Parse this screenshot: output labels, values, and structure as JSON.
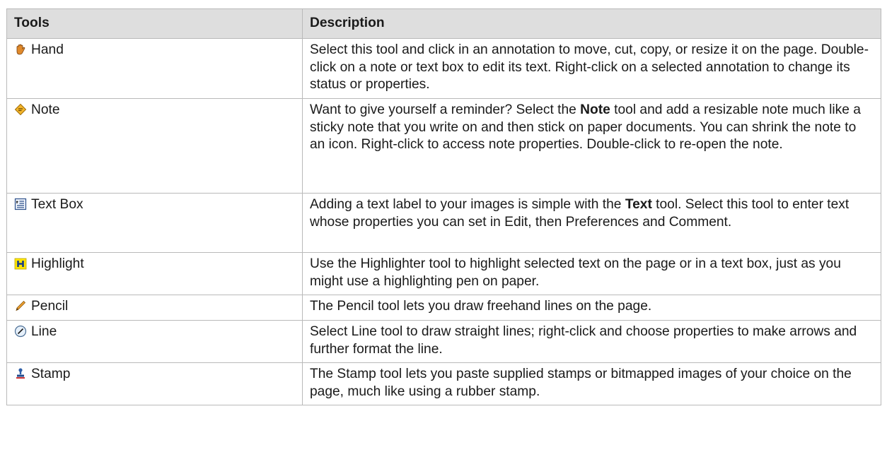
{
  "headers": {
    "tools": "Tools",
    "description": "Description"
  },
  "rows": [
    {
      "tool": "Hand",
      "icon": "hand-icon",
      "parts": [
        "Select this tool and click in an annotation to move, cut, copy, or resize it on the page. Double-click on a note or text box to edit its text. Right-click on a selected annotation to change its status or properties."
      ]
    },
    {
      "tool": "Note",
      "icon": "note-icon",
      "parts": [
        "Want to give yourself a reminder? Select the ",
        "Note",
        " tool and add a resizable note much like a sticky note that you write on and then stick on paper documents. You can shrink the note to an icon. Right-click to access note properties. Double-click to re-open the note."
      ]
    },
    {
      "tool": "Text Box",
      "icon": "text-box-icon",
      "parts": [
        "Adding a text label to your images is simple with the ",
        "Text",
        " tool. Select this tool to enter text whose properties you can set in Edit, then Preferences and Comment."
      ]
    },
    {
      "tool": "Highlight",
      "icon": "highlight-icon",
      "parts": [
        "Use the Highlighter tool to highlight selected text on the page or in a text box, just as you might use a highlighting pen on paper."
      ]
    },
    {
      "tool": "Pencil",
      "icon": "pencil-icon",
      "parts": [
        "The Pencil tool lets you draw freehand lines on the page."
      ]
    },
    {
      "tool": "Line",
      "icon": "line-icon",
      "parts": [
        "Select Line tool to draw straight lines; right-click and choose properties to make arrows and further format the line."
      ]
    },
    {
      "tool": "Stamp",
      "icon": "stamp-icon",
      "parts": [
        "The Stamp tool lets you paste supplied stamps or bitmapped images of your choice on the page, much like using a rubber stamp."
      ]
    }
  ]
}
